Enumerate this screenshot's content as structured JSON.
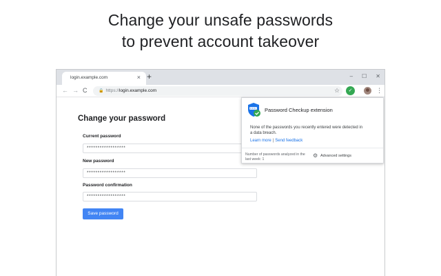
{
  "headline": {
    "line1": "Change your unsafe passwords",
    "line2": "to prevent account takeover"
  },
  "browser": {
    "tab": {
      "title": "login.example.com",
      "close_icon": "×"
    },
    "new_tab_icon": "+",
    "window_controls": [
      "–",
      "☐",
      "✕"
    ],
    "nav": {
      "back": "←",
      "forward": "→",
      "reload": "C"
    },
    "address": {
      "scheme": "https://",
      "host": "login.example.com"
    },
    "star_icon": "☆",
    "menu_icon": "⋮"
  },
  "page": {
    "title": "Change your password",
    "fields": [
      {
        "label": "Current password",
        "value": "******************"
      },
      {
        "label": "New password",
        "value": "******************"
      },
      {
        "label": "Password confirmation",
        "value": "******************"
      }
    ],
    "save_label": "Save password"
  },
  "popup": {
    "title": "Password Checkup extension",
    "message": "None of the passwords you recently entered were detected in a data breach.",
    "learn_more": "Learn more",
    "separator": "|",
    "send_feedback": "Send feedback",
    "footer": "Number of passwords analyzed in the last week: 1",
    "advanced_settings": "Advanced settings"
  },
  "colors": {
    "accent_blue": "#4285f4",
    "link_blue": "#1a73e8",
    "check_green": "#34a853",
    "shield_blue": "#1a73e8"
  }
}
